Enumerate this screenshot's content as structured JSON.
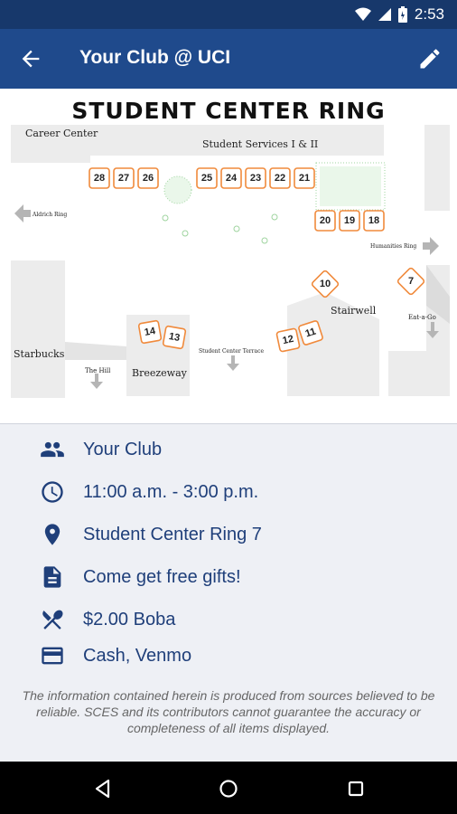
{
  "status_bar": {
    "time": "2:53"
  },
  "app_bar": {
    "title": "Your Club @ UCI"
  },
  "map": {
    "title": "STUDENT CENTER RING",
    "labels": {
      "career_center": "Career Center",
      "student_services": "Student Services I & II",
      "aldrich_ring": "Aldrich Ring",
      "humanities_ring": "Humanities Ring",
      "stairwell": "Stairwell",
      "eat_a_go": "Eat-a-Go",
      "starbucks": "Starbucks",
      "the_hill": "The Hill",
      "breezeway": "Breezeway",
      "student_center_terrace": "Student Center Terrace"
    },
    "booths": [
      "28",
      "27",
      "26",
      "25",
      "24",
      "23",
      "22",
      "21",
      "20",
      "19",
      "18",
      "14",
      "13",
      "12",
      "11",
      "10",
      "7"
    ]
  },
  "details": {
    "club": "Your Club",
    "time": "11:00 a.m. - 3:00 p.m.",
    "location": "Student Center Ring 7",
    "description": "Come get free gifts!",
    "food": "$2.00 Boba",
    "payment": "Cash, Venmo"
  },
  "disclaimer": "The information contained herein is produced from sources believed to be reliable. SCES and its contributors cannot guarantee the accuracy or completeness of all items displayed.",
  "colors": {
    "primary": "#1f4a8c",
    "status": "#17386b",
    "booth_border": "#f08a3c",
    "text_accent": "#1f3f7a"
  }
}
